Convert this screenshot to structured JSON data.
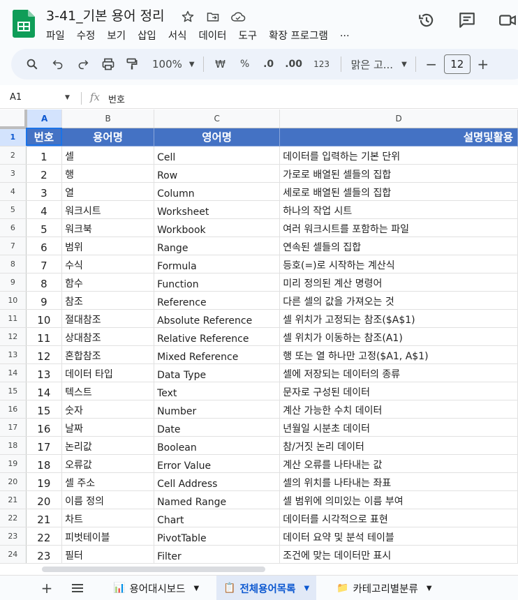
{
  "app": {
    "title": "3-41_기본 용어 정리",
    "menus": [
      "파일",
      "수정",
      "보기",
      "삽입",
      "서식",
      "데이터",
      "도구",
      "확장 프로그램",
      "..."
    ]
  },
  "toolbar": {
    "zoom": "100%",
    "currency": "₩",
    "percent": "%",
    "dec_decrease": ".0",
    "dec_increase": ".00",
    "number_format": "123",
    "font_name": "맑은 고...",
    "font_size": "12"
  },
  "formula_bar": {
    "cell_ref": "A1",
    "content": "번호"
  },
  "grid": {
    "columns": [
      "A",
      "B",
      "C",
      "D"
    ],
    "header": [
      "번호",
      "용어명",
      "영어명",
      "설명및활용"
    ],
    "rows": [
      [
        "1",
        "셀",
        "Cell",
        "데이터를 입력하는 기본 단위"
      ],
      [
        "2",
        "행",
        "Row",
        "가로로 배열된 셀들의 집합"
      ],
      [
        "3",
        "열",
        "Column",
        "세로로 배열된 셀들의 집합"
      ],
      [
        "4",
        "워크시트",
        "Worksheet",
        "하나의 작업 시트"
      ],
      [
        "5",
        "워크북",
        "Workbook",
        "여러 워크시트를 포함하는 파일"
      ],
      [
        "6",
        "범위",
        "Range",
        "연속된 셀들의 집합"
      ],
      [
        "7",
        "수식",
        "Formula",
        "등호(=)로 시작하는 계산식"
      ],
      [
        "8",
        "함수",
        "Function",
        "미리 정의된 계산 명령어"
      ],
      [
        "9",
        "참조",
        "Reference",
        "다른 셀의 값을 가져오는 것"
      ],
      [
        "10",
        "절대참조",
        "Absolute Reference",
        "셀 위치가 고정되는 참조($A$1)"
      ],
      [
        "11",
        "상대참조",
        "Relative Reference",
        "셀 위치가 이동하는 참조(A1)"
      ],
      [
        "12",
        "혼합참조",
        "Mixed Reference",
        "행 또는 열 하나만 고정($A1, A$1)"
      ],
      [
        "13",
        "데이터 타입",
        "Data Type",
        "셀에 저장되는 데이터의 종류"
      ],
      [
        "14",
        "텍스트",
        "Text",
        "문자로 구성된 데이터"
      ],
      [
        "15",
        "숫자",
        "Number",
        "계산 가능한 수치 데이터"
      ],
      [
        "16",
        "날짜",
        "Date",
        "년월일 시분초 데이터"
      ],
      [
        "17",
        "논리값",
        "Boolean",
        "참/거짓 논리 데이터"
      ],
      [
        "18",
        "오류값",
        "Error Value",
        "계산 오류를 나타내는 값"
      ],
      [
        "19",
        "셀 주소",
        "Cell Address",
        "셀의 위치를 나타내는 좌표"
      ],
      [
        "20",
        "이름 정의",
        "Named Range",
        "셀 범위에 의미있는 이름 부여"
      ],
      [
        "21",
        "차트",
        "Chart",
        "데이터를 시각적으로 표현"
      ],
      [
        "22",
        "피벗테이블",
        "PivotTable",
        "데이터 요약 및 분석 테이블"
      ],
      [
        "23",
        "필터",
        "Filter",
        "조건에 맞는 데이터만 표시"
      ]
    ]
  },
  "sheets": {
    "tabs": [
      {
        "label": "용어대시보드",
        "icon": "chart-icon",
        "active": false
      },
      {
        "label": "전체용어목록",
        "icon": "clipboard-icon",
        "active": true
      },
      {
        "label": "카테고리별분류",
        "icon": "folder-icon",
        "active": false
      }
    ]
  },
  "colors": {
    "header_fill": "#4472c4",
    "header_text": "#ffffff",
    "selection": "#1a73e8",
    "active_tab": "#0b57d0"
  }
}
